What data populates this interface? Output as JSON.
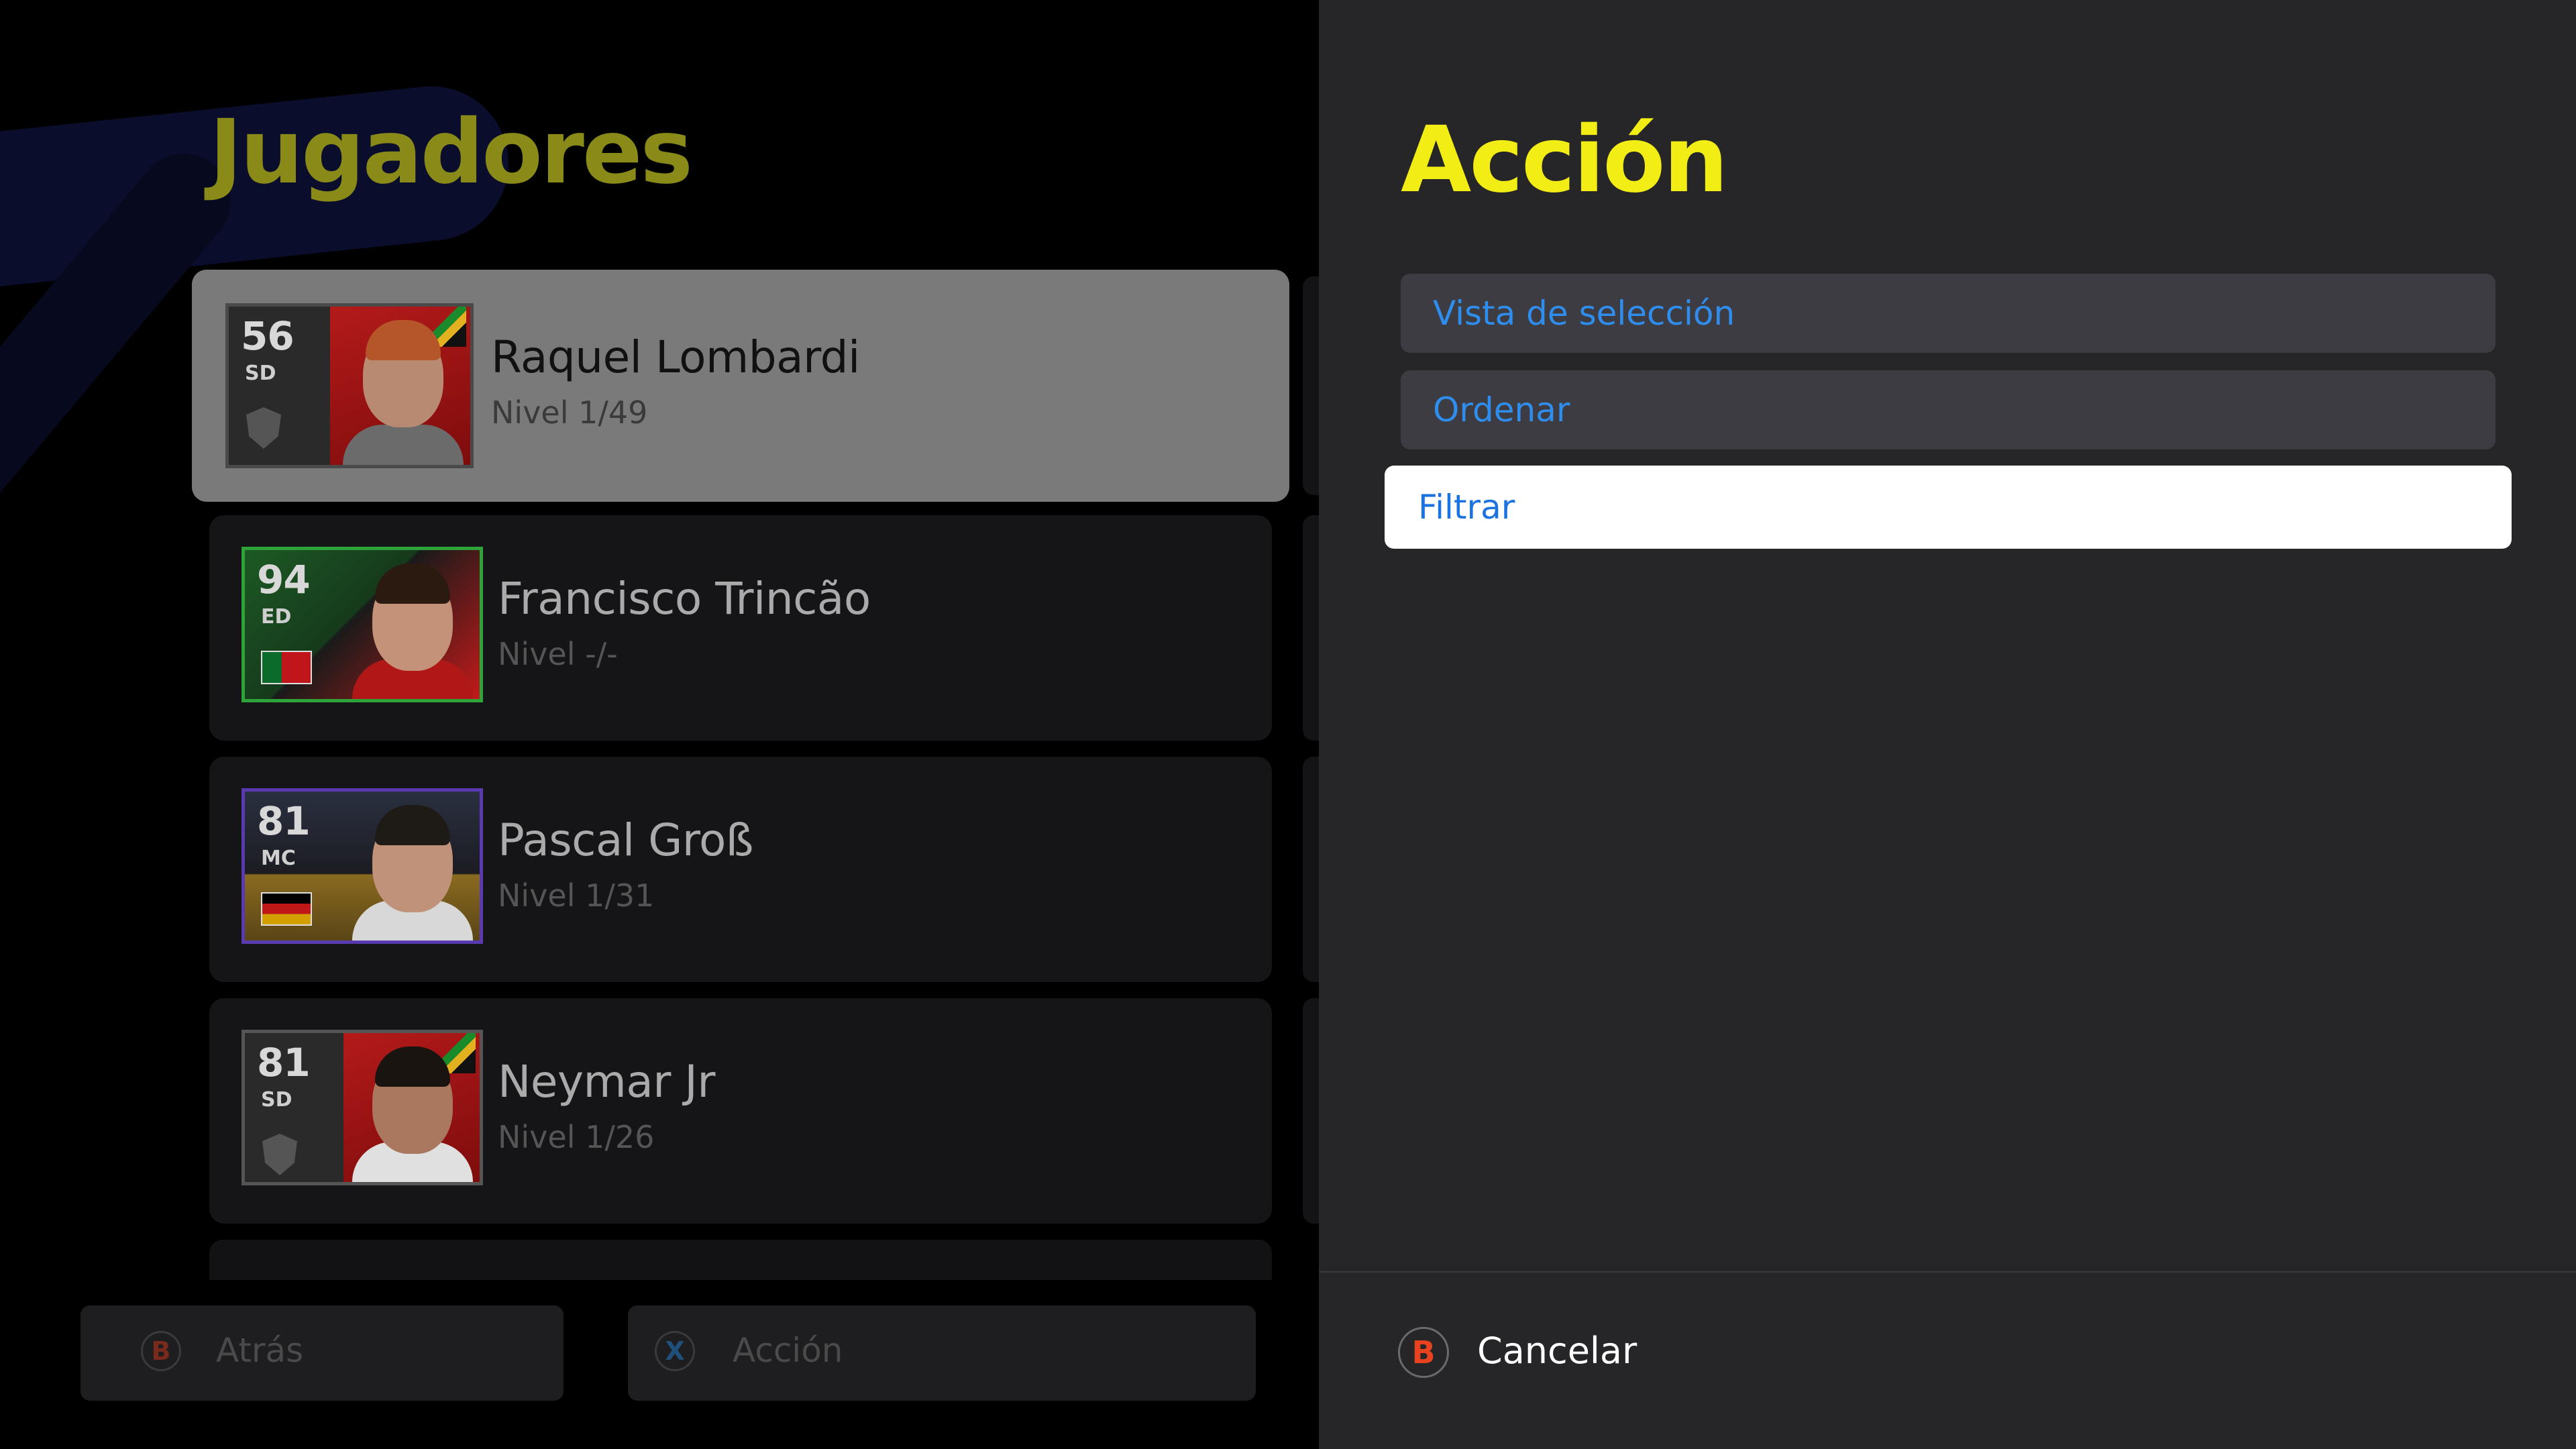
{
  "players_panel": {
    "title": "Jugadores",
    "players": [
      {
        "rating": "56",
        "position": "SD",
        "name": "Raquel Lombardi",
        "level": "Nivel 1/49",
        "selected": true
      },
      {
        "rating": "94",
        "position": "ED",
        "name": "Francisco Trincão",
        "level": "Nivel -/-",
        "selected": false
      },
      {
        "rating": "81",
        "position": "MC",
        "name": "Pascal Groß",
        "level": "Nivel 1/31",
        "selected": false
      },
      {
        "rating": "81",
        "position": "SD",
        "name": "Neymar Jr",
        "level": "Nivel 1/26",
        "selected": false
      }
    ]
  },
  "bottom_bar": {
    "back": {
      "glyph": "B",
      "label": "Atrás",
      "glyph_color": "#7a2a1a"
    },
    "action": {
      "glyph": "X",
      "label": "Acción",
      "glyph_color": "#1f4f7a"
    }
  },
  "action_panel": {
    "title": "Acción",
    "items": [
      {
        "label": "Vista de selección",
        "focused": false
      },
      {
        "label": "Ordenar",
        "focused": false
      },
      {
        "label": "Filtrar",
        "focused": true
      }
    ],
    "cancel": {
      "glyph": "B",
      "label": "Cancelar"
    }
  },
  "colors": {
    "title_yellow": "#f2ee15",
    "menu_text_blue": "#2f8eed",
    "cancel_glyph_red": "#e8431e"
  }
}
